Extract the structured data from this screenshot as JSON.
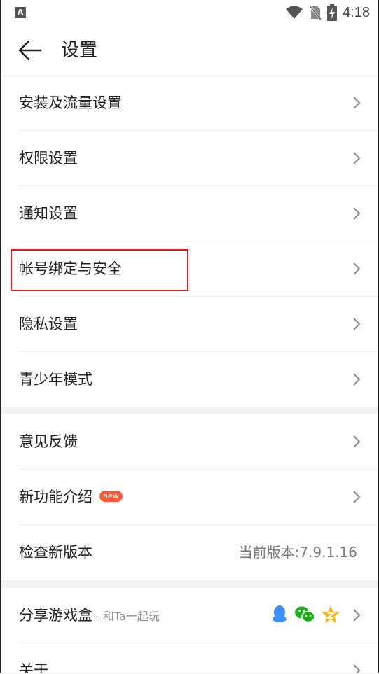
{
  "status_bar": {
    "time": "4:18",
    "app_icon_letter": "A"
  },
  "header": {
    "title": "设置"
  },
  "section1": [
    {
      "label": "安装及流量设置"
    },
    {
      "label": "权限设置"
    },
    {
      "label": "通知设置"
    },
    {
      "label": "帐号绑定与安全"
    },
    {
      "label": "隐私设置"
    },
    {
      "label": "青少年模式"
    }
  ],
  "section2": {
    "feedback": {
      "label": "意见反馈"
    },
    "new_features": {
      "label": "新功能介绍",
      "badge": "new"
    },
    "check_update": {
      "label": "检查新版本",
      "value": "当前版本:7.9.1.16"
    }
  },
  "section3": {
    "share": {
      "label": "分享游戏盒",
      "subtitle": "- 和Ta一起玩"
    },
    "about": {
      "label": "关于"
    }
  },
  "colors": {
    "accent_red": "#e02020",
    "new_badge": "#ff5a3c",
    "qq_blue": "#3d8ef8",
    "wechat_green": "#1aad19",
    "qzone_yellow": "#f6b51d"
  },
  "icons": [
    "back-arrow-icon",
    "wifi-icon",
    "no-sim-icon",
    "battery-charging-icon",
    "chevron-right-icon",
    "qq-icon",
    "wechat-icon",
    "qzone-icon"
  ]
}
